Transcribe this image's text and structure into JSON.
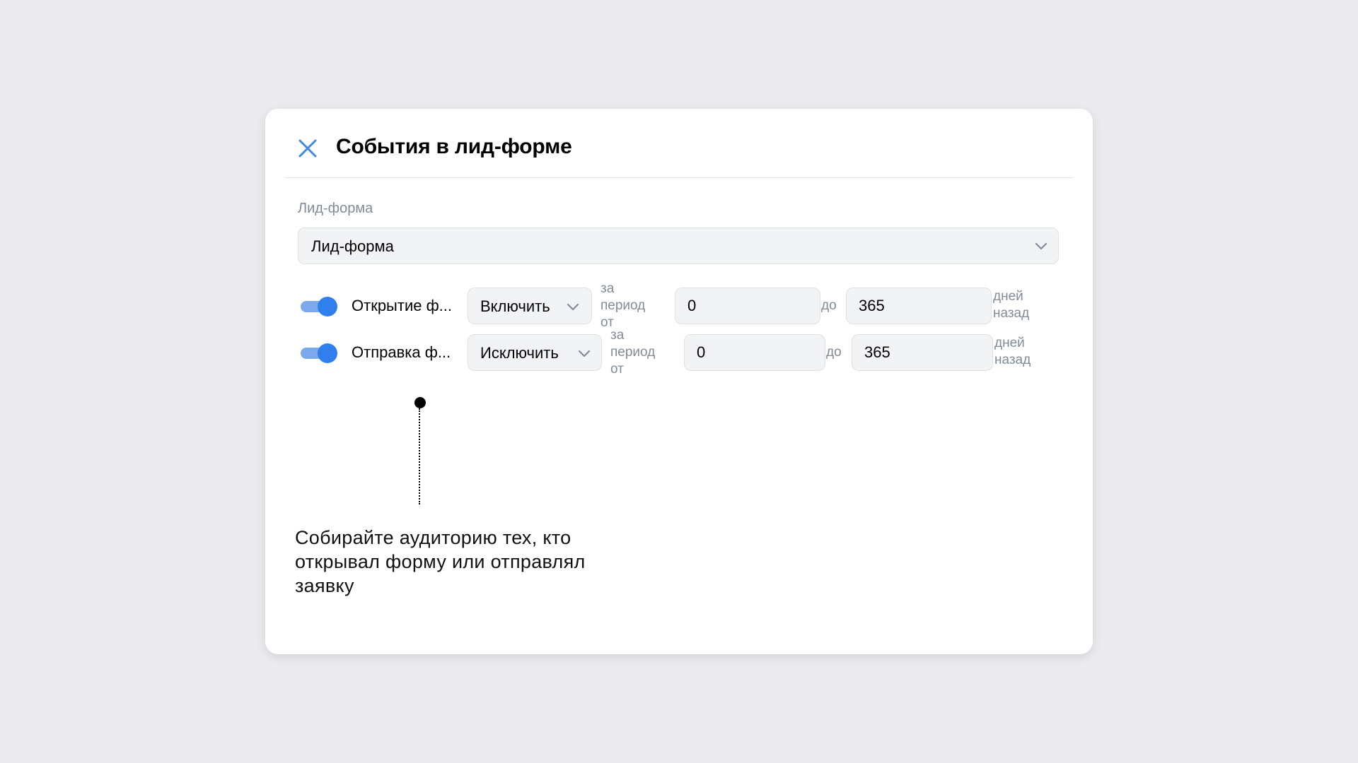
{
  "modal": {
    "title": "События в лид-форме"
  },
  "lead_form": {
    "label": "Лид-форма",
    "selected": "Лид-форма"
  },
  "events": [
    {
      "enabled": true,
      "name": "Открытие ф...",
      "mode": "Включить",
      "period_prefix": "за период от",
      "from": "0",
      "to_label": "до",
      "to": "365",
      "suffix": "дней назад"
    },
    {
      "enabled": true,
      "name": "Отправка ф...",
      "mode": "Исключить",
      "period_prefix": "за период от",
      "from": "0",
      "to_label": "до",
      "to": "365",
      "suffix": "дней назад"
    }
  ],
  "caption": "Собирайте аудиторию тех, кто открывал форму или отправлял заявку",
  "colors": {
    "accent": "#2f80ed",
    "toggle_track": "#7da9ec",
    "background": "#ebebef",
    "field_bg": "#f2f3f5",
    "muted_text": "#818c99"
  }
}
